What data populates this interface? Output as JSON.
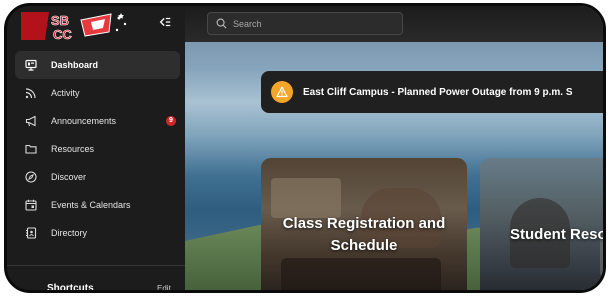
{
  "logo": {
    "text": "SBCC"
  },
  "sidebar": {
    "items": [
      {
        "label": "Dashboard",
        "icon": "dashboard-icon",
        "active": true
      },
      {
        "label": "Activity",
        "icon": "activity-icon"
      },
      {
        "label": "Announcements",
        "icon": "megaphone-icon",
        "badge": "9"
      },
      {
        "label": "Resources",
        "icon": "folder-icon"
      },
      {
        "label": "Discover",
        "icon": "compass-icon"
      },
      {
        "label": "Events & Calendars",
        "icon": "calendar-icon"
      },
      {
        "label": "Directory",
        "icon": "directory-icon"
      }
    ],
    "shortcuts_label": "Shortcuts",
    "edit_label": "Edit"
  },
  "search": {
    "placeholder": "Search"
  },
  "alert": {
    "text": "East Cliff Campus - Planned Power Outage from 9 p.m. S"
  },
  "cards": [
    {
      "title": "Class Registration and Schedule"
    },
    {
      "title": "Student Reso"
    }
  ],
  "colors": {
    "sidebar_bg": "#1c1c1c",
    "active_item_bg": "#2e2e2e",
    "badge": "#d0262a",
    "alert_icon": "#f4a52a",
    "alert_bg": "#202020"
  }
}
